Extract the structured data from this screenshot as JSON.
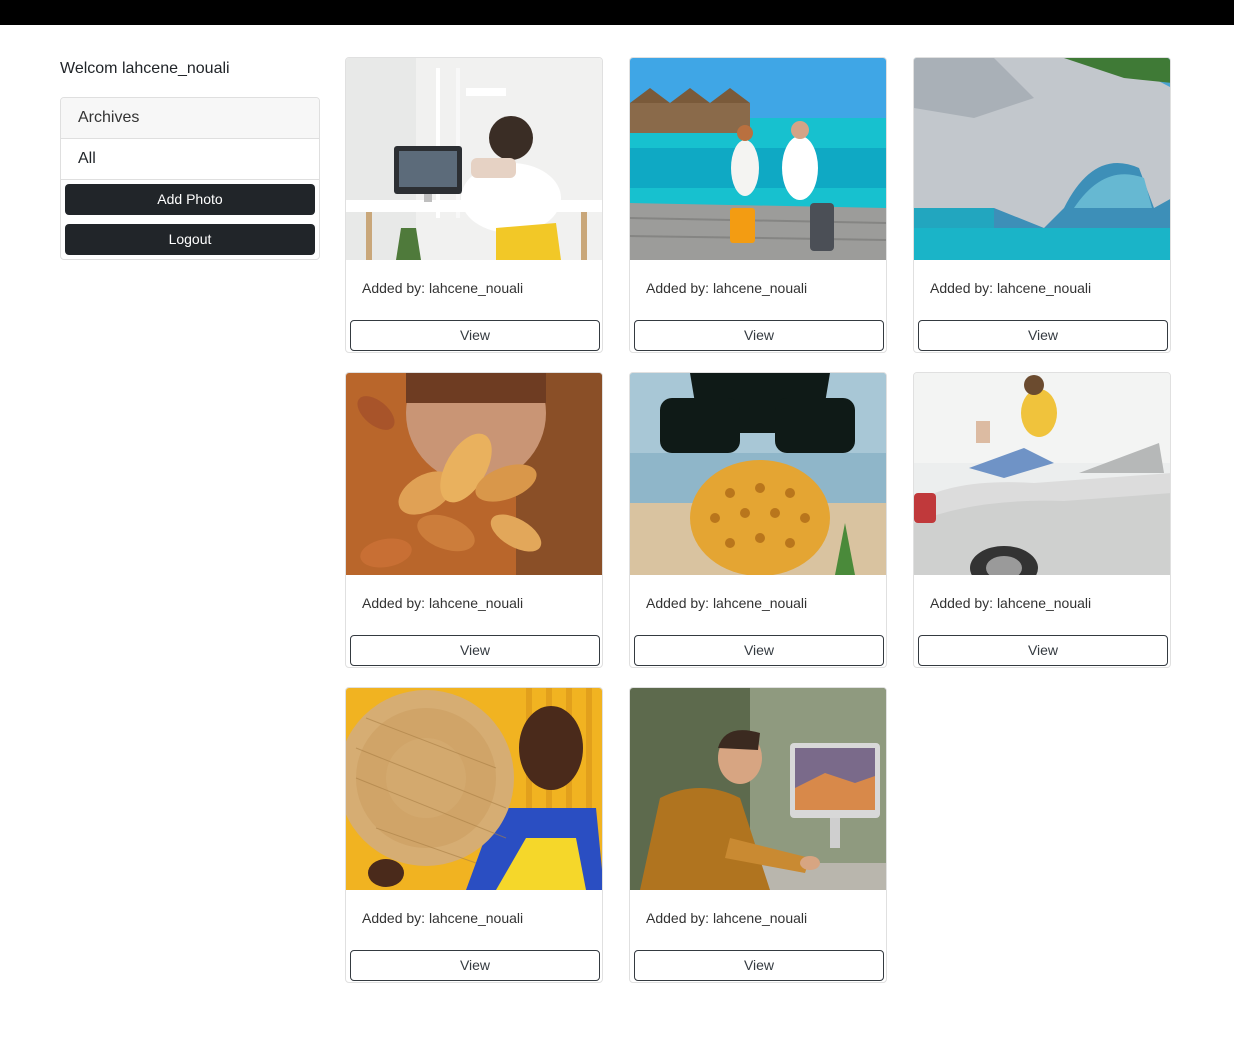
{
  "topbar": {},
  "sidebar": {
    "welcome": "Welcom lahcene_nouali",
    "archives_header": "Archives",
    "items": [
      {
        "label": "All"
      }
    ],
    "add_photo_label": "Add Photo",
    "logout_label": "Logout"
  },
  "gallery": {
    "cards": [
      {
        "photo": "person-at-desk-computer-photo",
        "caption": "Added by: lahcene_nouali",
        "button": "View"
      },
      {
        "photo": "couple-walking-pier-luggage-photo",
        "caption": "Added by: lahcene_nouali",
        "button": "View"
      },
      {
        "photo": "coastal-rock-arch-photo",
        "caption": "Added by: lahcene_nouali",
        "button": "View"
      },
      {
        "photo": "autumn-leaves-face-photo",
        "caption": "Added by: lahcene_nouali",
        "button": "View"
      },
      {
        "photo": "pineapple-sunglasses-beach-photo",
        "caption": "Added by: lahcene_nouali",
        "button": "View"
      },
      {
        "photo": "woman-sitting-on-car-photo",
        "caption": "Added by: lahcene_nouali",
        "button": "View"
      },
      {
        "photo": "woman-woven-hat-yellow-photo",
        "caption": "Added by: lahcene_nouali",
        "button": "View"
      },
      {
        "photo": "man-writing-at-imac-photo",
        "caption": "Added by: lahcene_nouali",
        "button": "View"
      }
    ]
  },
  "colors": {
    "topbar": "#000000",
    "button_dark": "#212529",
    "border": "#dfdfdf",
    "panel_header_bg": "#f7f7f7"
  }
}
